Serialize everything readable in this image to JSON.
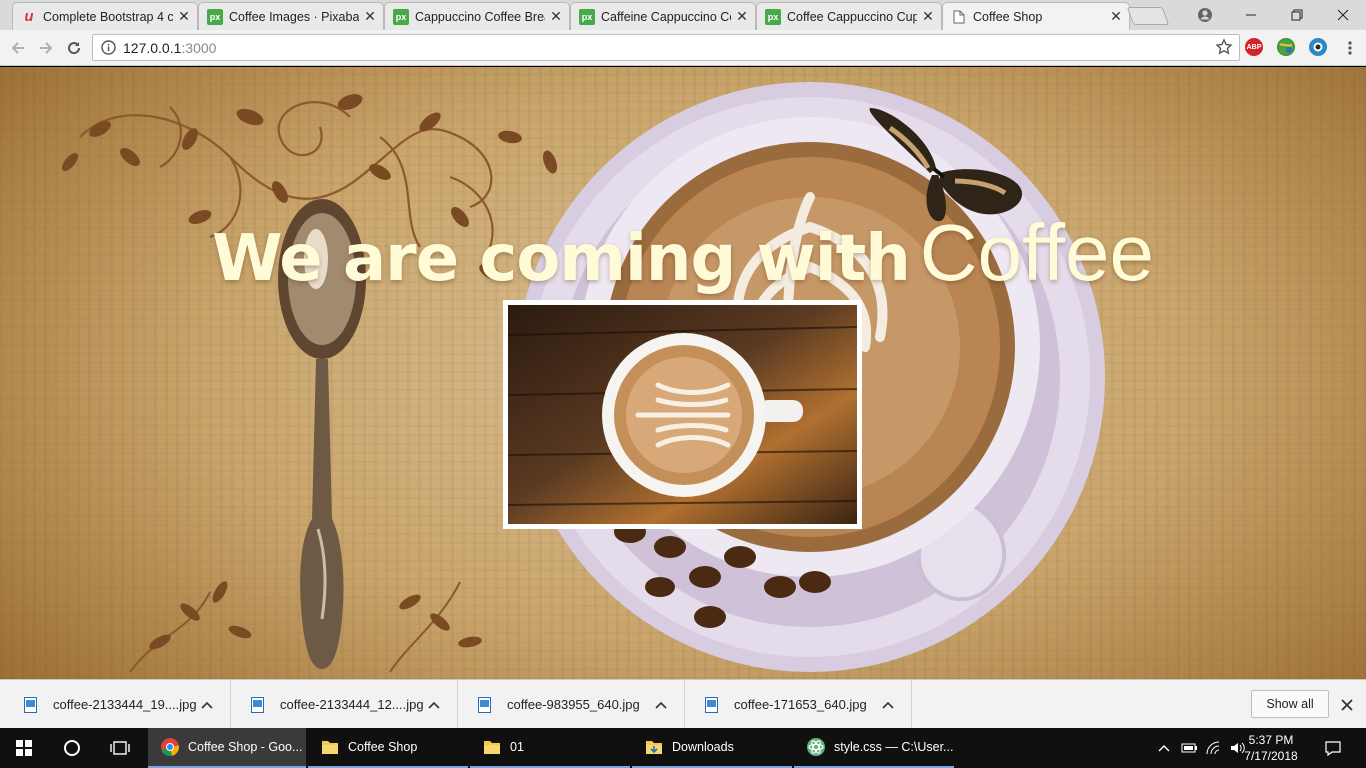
{
  "browser": {
    "tabs": [
      {
        "title": "Complete Bootstrap 4 c",
        "favicon": "udemy-icon",
        "active": false
      },
      {
        "title": "Coffee Images · Pixabay",
        "favicon": "pixabay-icon",
        "active": false
      },
      {
        "title": "Cappuccino Coffee Brea",
        "favicon": "pixabay-icon",
        "active": false
      },
      {
        "title": "Caffeine Cappuccino Co",
        "favicon": "pixabay-icon",
        "active": false
      },
      {
        "title": "Coffee Cappuccino Cup",
        "favicon": "pixabay-icon",
        "active": false
      },
      {
        "title": "Coffee Shop",
        "favicon": "page-icon",
        "active": true
      }
    ],
    "url_host": "127.0.0.1",
    "url_port": ":3000",
    "extensions": [
      {
        "name": "adblock-plus-icon",
        "label": "ABP",
        "color": "#d3232b"
      },
      {
        "name": "extension-globe-icon",
        "label": "",
        "color": "#3b8b3b"
      },
      {
        "name": "extension-circle-icon",
        "label": "",
        "color": "#2f86c6"
      }
    ]
  },
  "page": {
    "hero_bold": "We are coming with",
    "hero_light": "Coffee",
    "hero_color": "#fffbd7"
  },
  "downloads": {
    "items": [
      {
        "name": "coffee-2133444_19....jpg"
      },
      {
        "name": "coffee-2133444_12....jpg"
      },
      {
        "name": "coffee-983955_640.jpg"
      },
      {
        "name": "coffee-171653_640.jpg"
      }
    ],
    "show_all": "Show all"
  },
  "taskbar": {
    "items": [
      {
        "label": "Coffee Shop - Goo...",
        "icon": "chrome-icon",
        "active": true
      },
      {
        "label": "Coffee Shop",
        "icon": "folder-icon",
        "active": false
      },
      {
        "label": "01",
        "icon": "folder-icon",
        "active": false
      },
      {
        "label": "Downloads",
        "icon": "downloads-folder-icon",
        "active": false
      },
      {
        "label": "style.css — C:\\User...",
        "icon": "atom-icon",
        "active": false
      }
    ],
    "time": "5:37 PM",
    "date": "7/17/2018"
  }
}
